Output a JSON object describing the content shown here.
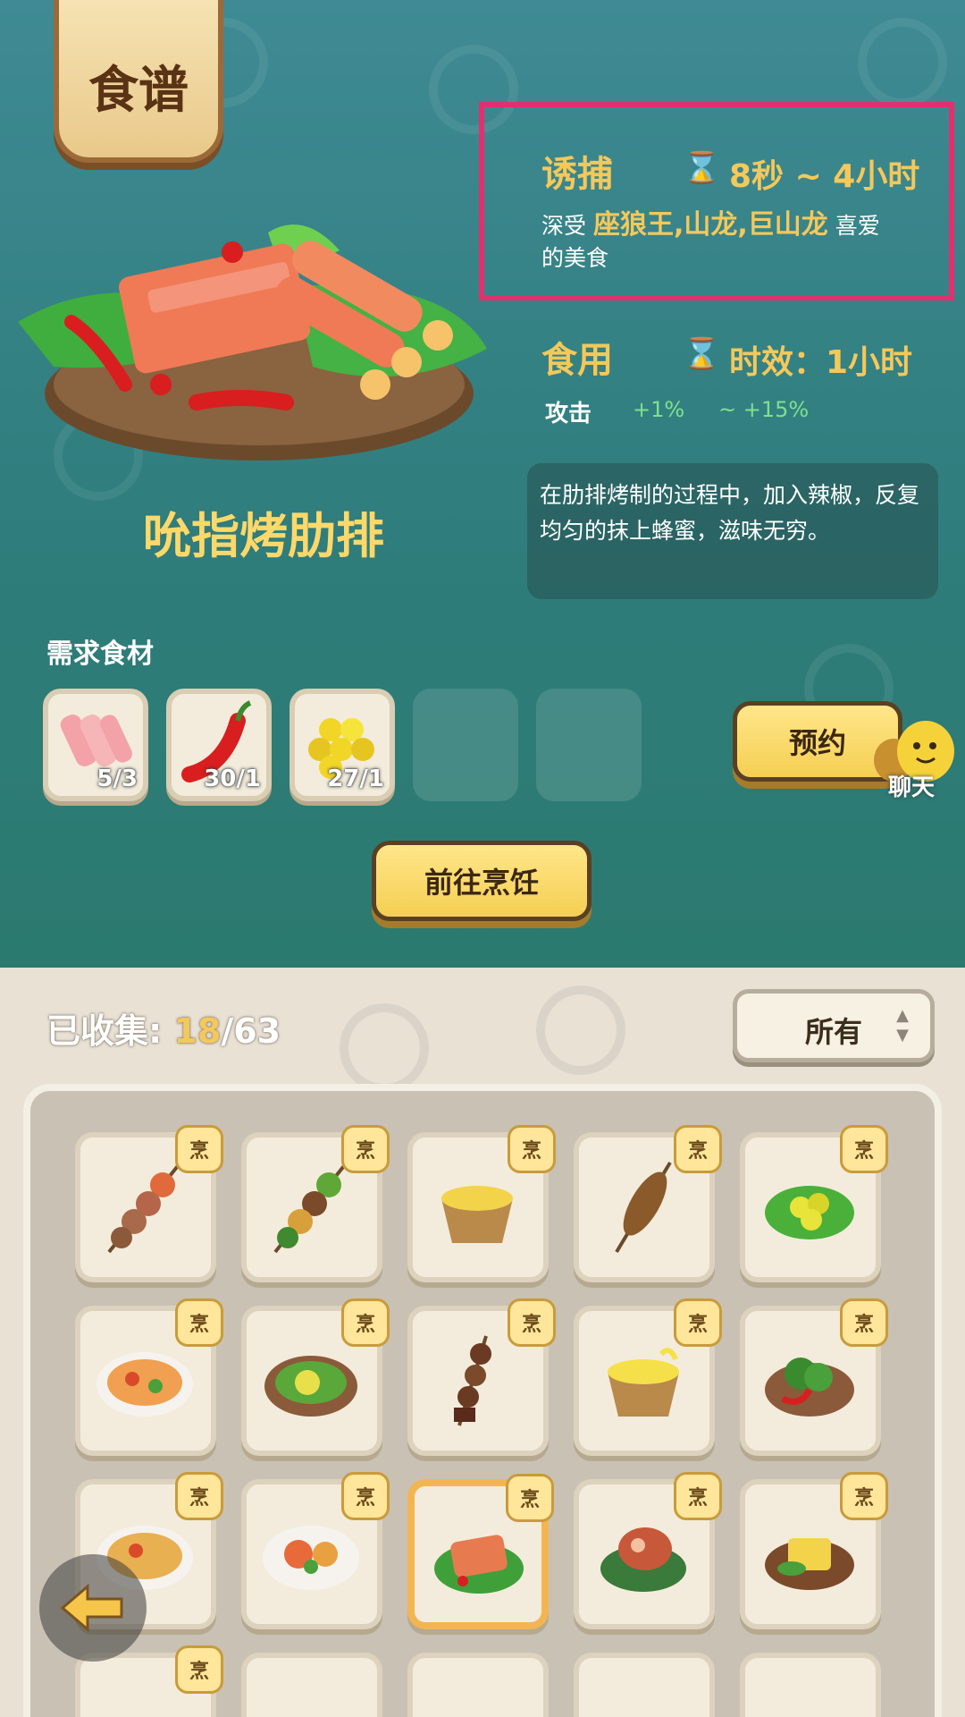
{
  "banner": {
    "title": "食谱"
  },
  "dish": {
    "name": "吮指烤肋排"
  },
  "lure": {
    "label": "诱捕",
    "time": "8秒 ~ 4小时",
    "desc_prefix": "深受",
    "creatures": "座狼王,山龙,巨山龙",
    "desc_suffix": "喜爱",
    "desc_line2": "的美食"
  },
  "eat": {
    "label": "食用",
    "duration": "时效：1小时",
    "stat_label": "攻击",
    "stat_min": "+1%",
    "stat_max": "~ +15%"
  },
  "description": "在肋排烤制的过程中，加入辣椒，反复均匀的抹上蜂蜜，滋味无穷。",
  "ingredients": {
    "label": "需求食材",
    "items": [
      {
        "icon": "ribs-meat-icon",
        "count": "5/3"
      },
      {
        "icon": "red-chili-icon",
        "count": "30/1"
      },
      {
        "icon": "honeycomb-icon",
        "count": "27/1"
      }
    ]
  },
  "buttons": {
    "reserve": "预约",
    "cook": "前往烹饪",
    "chat": "聊天"
  },
  "collection": {
    "label": "已收集:",
    "collected": "18",
    "total": "/63",
    "filter": "所有"
  },
  "badge_text": "烹",
  "colors": {
    "accent_yellow": "#f5c85a",
    "highlight_border": "#e0306e",
    "stat_green": "#7fe08a"
  }
}
